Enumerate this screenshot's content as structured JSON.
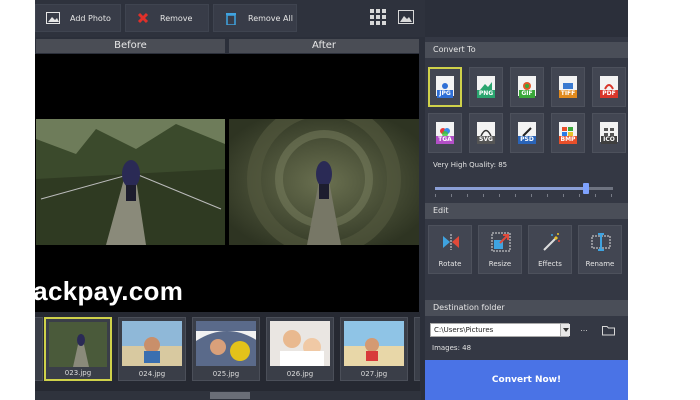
{
  "toolbar": {
    "add_photo": "Add Photo",
    "remove": "Remove",
    "remove_all": "Remove All",
    "icons": [
      "image-icon",
      "red-x-icon",
      "trash-icon",
      "grid-view-icon",
      "single-view-icon"
    ]
  },
  "preview": {
    "before_label": "Before",
    "after_label": "After"
  },
  "watermark": "crackpay.com",
  "thumbnails": [
    {
      "label": "023.jpg",
      "selected": true
    },
    {
      "label": "024.jpg",
      "selected": false
    },
    {
      "label": "025.jpg",
      "selected": false
    },
    {
      "label": "026.jpg",
      "selected": false
    },
    {
      "label": "027.jpg",
      "selected": false
    }
  ],
  "convert_to": {
    "header": "Convert To",
    "formats": [
      {
        "label": "JPG",
        "color": "#2f6fd6",
        "selected": true
      },
      {
        "label": "PNG",
        "color": "#2aa56f",
        "selected": false
      },
      {
        "label": "GIF",
        "color": "#3aa83a",
        "selected": false
      },
      {
        "label": "TIFF",
        "color": "#e08a1e",
        "selected": false
      },
      {
        "label": "PDF",
        "color": "#d8362a",
        "selected": false
      },
      {
        "label": "TGA",
        "color": "#b24fc7",
        "selected": false
      },
      {
        "label": "SVG",
        "color": "#555555",
        "selected": false
      },
      {
        "label": "PSD",
        "color": "#2a64b8",
        "selected": false
      },
      {
        "label": "BMP",
        "color": "#e84f2a",
        "selected": false
      },
      {
        "label": "ICO",
        "color": "#3f3f3f",
        "selected": false
      }
    ],
    "quality_label": "Very High Quality: 85",
    "quality_value": 85
  },
  "edit": {
    "header": "Edit",
    "buttons": [
      {
        "label": "Rotate",
        "icon": "rotate-icon"
      },
      {
        "label": "Resize",
        "icon": "resize-icon"
      },
      {
        "label": "Effects",
        "icon": "magic-wand-icon"
      },
      {
        "label": "Rename",
        "icon": "rename-icon"
      }
    ]
  },
  "destination": {
    "header": "Destination folder",
    "path": "C:\\Users\\Pictures",
    "dots": "...",
    "images_count": "Images: 48"
  },
  "convert_button": "Convert Now!",
  "colors": {
    "accent": "#4a73e6",
    "selection": "#cfd14a",
    "panel": "#343844"
  }
}
